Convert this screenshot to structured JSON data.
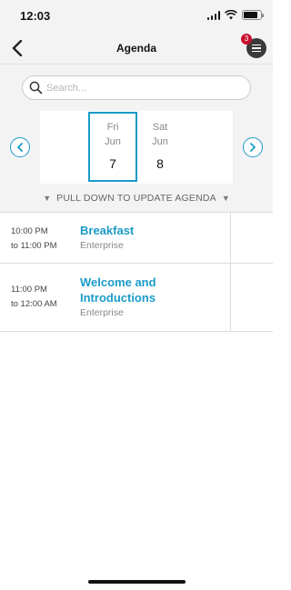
{
  "status_bar": {
    "time": "12:03"
  },
  "nav": {
    "title": "Agenda",
    "notification_count": "3",
    "back_icon": "chevron-left-icon",
    "menu_icon": "hamburger-menu-icon"
  },
  "search": {
    "placeholder": "Search...",
    "value": ""
  },
  "dates": [
    {
      "day": "Fri",
      "month": "Jun",
      "date": "7",
      "selected": true
    },
    {
      "day": "Sat",
      "month": "Jun",
      "date": "8",
      "selected": false
    }
  ],
  "pull_hint": {
    "text": "PULL DOWN TO UPDATE AGENDA",
    "arrow": "▼"
  },
  "sessions": [
    {
      "start": "10:00 PM",
      "end": "to 11:00 PM",
      "title": "Breakfast",
      "location": "Enterprise"
    },
    {
      "start": "11:00 PM",
      "end": "to 12:00 AM",
      "title": "Welcome and Introductions",
      "location": "Enterprise"
    }
  ],
  "colors": {
    "accent": "#1a9bc8",
    "badge": "#c8102e",
    "chrome_bg": "#f3f3f3"
  }
}
